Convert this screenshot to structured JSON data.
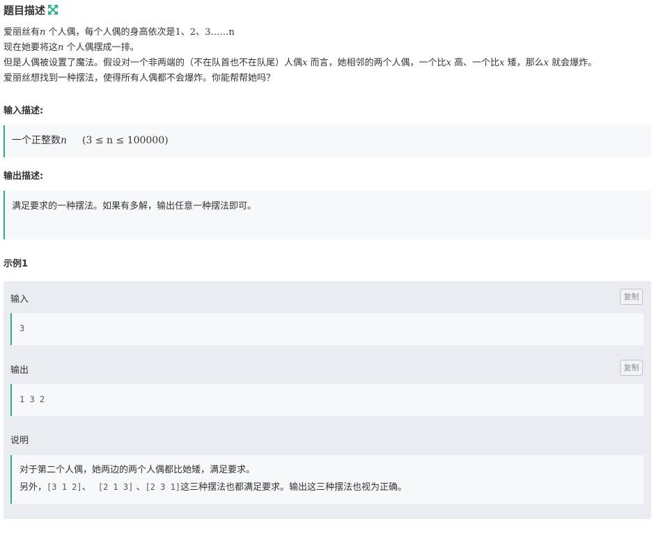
{
  "header": {
    "title": "题目描述",
    "expand_icon_color": "#27b28a"
  },
  "description": {
    "line1": {
      "a": "爱丽丝有",
      "n": "n",
      "b": " 个人偶，每个人偶的身高依次是",
      "seq": "1、2、3……n"
    },
    "line2": {
      "a": "现在她要将这",
      "n": "n",
      "b": " 个人偶摆成一排。"
    },
    "line3": {
      "a": "但是人偶被设置了魔法。假设对一个非两端的（不在队首也不在队尾）人偶",
      "x1": "x",
      "b": " 而言，她相邻的两个人偶，一个比",
      "x2": "x",
      "c": " 高、一个比",
      "x3": "x",
      "d": " 矮，那么",
      "x4": "x",
      "e": " 就会爆炸。"
    },
    "line4": "爱丽丝想找到一种摆法，使得所有人偶都不会爆炸。你能帮帮她吗？"
  },
  "input_section": {
    "label": "输入描述:",
    "text": "一个正整数",
    "n": "n",
    "constraint": "(3 ≤ n ≤ 100000)"
  },
  "output_section": {
    "label": "输出描述:",
    "text": "满足要求的一种摆法。如果有多解，输出任意一种摆法即可。"
  },
  "example": {
    "title": "示例1",
    "input_label": "输入",
    "input_value": "3",
    "output_label": "输出",
    "output_value": "1 3 2",
    "copy_label": "复制",
    "note_label": "说明",
    "note_line1": "对于第二个人偶，她两边的两个人偶都比她矮，满足要求。",
    "note_line2": {
      "a": "另外，",
      "p1": "[3 1 2]",
      "sep1": "、 ",
      "p2": "[2 1 3]",
      "sep2": " 、",
      "p3": "[2 3 1]",
      "b": "这三种摆法也都满足要求。输出这三种摆法也视为正确。"
    }
  },
  "colors": {
    "accent": "#27b28a",
    "box_bg": "#f7f8f9",
    "example_bg": "#eaecf1"
  }
}
